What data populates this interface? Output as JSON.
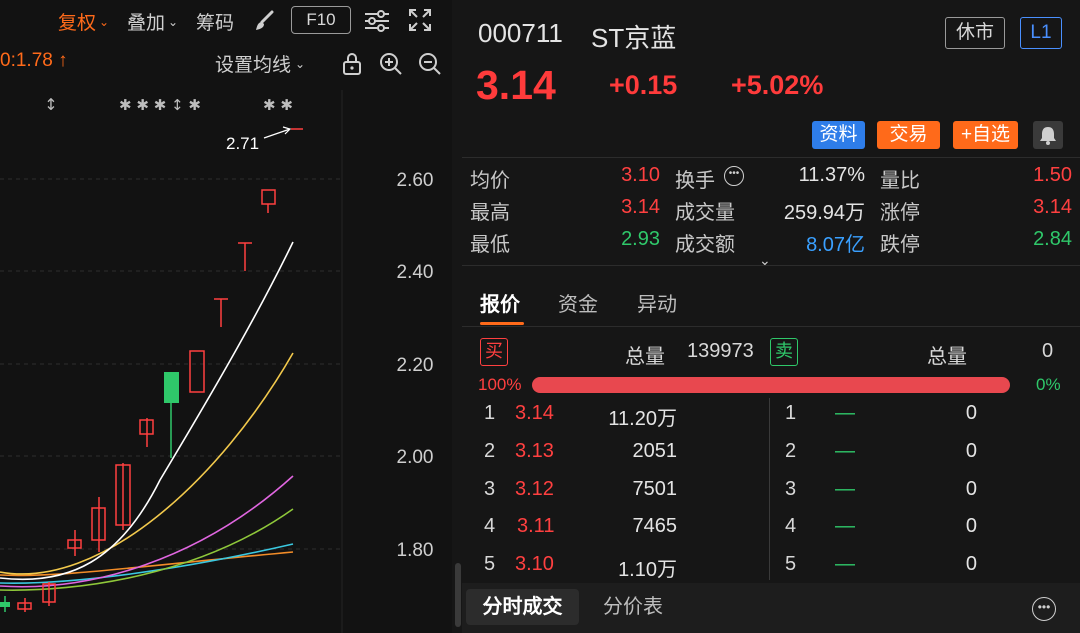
{
  "toolbar": {
    "adjust_label": "复权",
    "overlay_label": "叠加",
    "chips_label": "筹码",
    "f10_label": "F10",
    "ma_value_label": "0:1.78 ↑",
    "ma_setting_label": "设置均线"
  },
  "chart": {
    "y_ticks": [
      "2.60",
      "2.40",
      "2.20",
      "2.00",
      "1.80"
    ],
    "max_label": "2.71",
    "event_markers": [
      "↕",
      "✱ ✱ ✱ ↕ ✱",
      "✱ ✱"
    ],
    "colors": {
      "up": "#ff4040",
      "down": "#2fc86a",
      "ma5": "#ffffff",
      "ma10": "#f2c94c",
      "ma20": "#e066e0",
      "ma30": "#8fc83a",
      "ma60": "#3ac8e0",
      "ma120": "#f28c28"
    }
  },
  "quote": {
    "code": "000711",
    "name": "ST京蓝",
    "status": "休市",
    "level": "L1",
    "price": "3.14",
    "change": "+0.15",
    "change_pct": "+5.02%"
  },
  "actions": {
    "profile": "资料",
    "trade": "交易",
    "watch": "+自选"
  },
  "stats": {
    "avg_label": "均价",
    "avg": "3.10",
    "turnover_label": "换手",
    "turnover": "11.37%",
    "vol_ratio_label": "量比",
    "vol_ratio": "1.50",
    "high_label": "最高",
    "high": "3.14",
    "volume_label": "成交量",
    "volume": "259.94万",
    "limit_up_label": "涨停",
    "limit_up": "3.14",
    "low_label": "最低",
    "low": "2.93",
    "amount_label": "成交额",
    "amount": "8.07亿",
    "limit_down_label": "跌停",
    "limit_down": "2.84"
  },
  "tabs": {
    "quote": "报价",
    "funds": "资金",
    "moves": "异动"
  },
  "book": {
    "buy_badge": "买",
    "sell_badge": "卖",
    "total_label": "总量",
    "buy_total": "139973",
    "sell_total": "0",
    "buy_pct": "100%",
    "buy_ratio": 1.0,
    "sell_pct": "0%",
    "bids": [
      {
        "level": "1",
        "price": "3.14",
        "volume": "11.20万"
      },
      {
        "level": "2",
        "price": "3.13",
        "volume": "2051"
      },
      {
        "level": "3",
        "price": "3.12",
        "volume": "7501"
      },
      {
        "level": "4",
        "price": "3.11",
        "volume": "7465"
      },
      {
        "level": "5",
        "price": "3.10",
        "volume": "1.10万"
      }
    ],
    "asks": [
      {
        "level": "1",
        "price": "—",
        "volume": "0"
      },
      {
        "level": "2",
        "price": "—",
        "volume": "0"
      },
      {
        "level": "3",
        "price": "—",
        "volume": "0"
      },
      {
        "level": "4",
        "price": "—",
        "volume": "0"
      },
      {
        "level": "5",
        "price": "—",
        "volume": "0"
      }
    ]
  },
  "bottom_tabs": {
    "trades": "分时成交",
    "prices": "分价表"
  }
}
